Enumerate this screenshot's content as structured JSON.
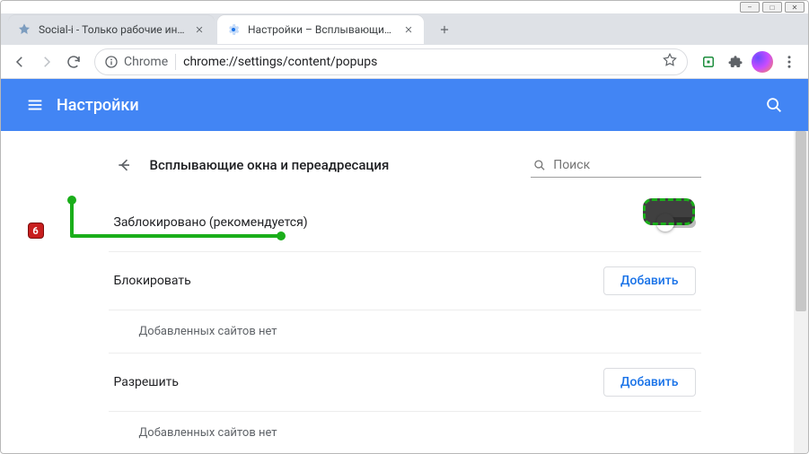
{
  "window": {
    "minimize": "–",
    "maximize": "□",
    "close": "✕"
  },
  "tabs": [
    {
      "title": "Social-i - Только рабочие инстр",
      "active": false
    },
    {
      "title": "Настройки – Всплывающие окн",
      "active": true
    }
  ],
  "toolbar": {
    "security_label": "Chrome",
    "url": "chrome://settings/content/popups"
  },
  "appbar": {
    "title": "Настройки"
  },
  "page": {
    "title": "Всплывающие окна и переадресация",
    "search_placeholder": "Поиск",
    "blocked_label": "Заблокировано (рекомендуется)",
    "sections": [
      {
        "heading": "Блокировать",
        "empty_text": "Добавленных сайтов нет",
        "add_label": "Добавить"
      },
      {
        "heading": "Разрешить",
        "empty_text": "Добавленных сайтов нет",
        "add_label": "Добавить"
      }
    ]
  },
  "annotation": {
    "badge": "6"
  }
}
